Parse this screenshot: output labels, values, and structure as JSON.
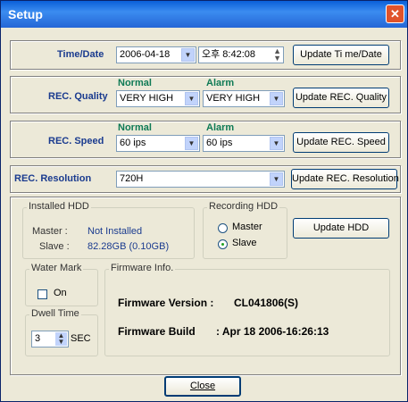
{
  "window": {
    "title": "Setup",
    "close_glyph": "✕"
  },
  "time_date": {
    "label": "Time/Date",
    "date": "2006-04-18",
    "time": "오후  8:42:08",
    "button": "Update Ti me/Date"
  },
  "rec_quality": {
    "label": "REC. Quality",
    "normal_header": "Normal",
    "alarm_header": "Alarm",
    "normal_value": "VERY HIGH",
    "alarm_value": "VERY HIGH",
    "button": "Update REC. Quality"
  },
  "rec_speed": {
    "label": "REC. Speed",
    "normal_header": "Normal",
    "alarm_header": "Alarm",
    "normal_value": "60 ips",
    "alarm_value": "60 ips",
    "button": "Update REC. Speed"
  },
  "rec_resolution": {
    "label": "REC. Resolution",
    "value": "720H",
    "button": "Update REC. Resolution"
  },
  "installed_hdd": {
    "legend": "Installed HDD",
    "master_label": "Master :",
    "master_value": "Not Installed",
    "slave_label": "Slave :",
    "slave_value": "82.28GB (0.10GB)"
  },
  "recording_hdd": {
    "legend": "Recording HDD",
    "option_master": "Master",
    "option_slave": "Slave",
    "selected": "Slave"
  },
  "update_hdd_button": "Update HDD",
  "water_mark": {
    "legend": "Water Mark",
    "checkbox_label": "On",
    "checked": false
  },
  "dwell_time": {
    "legend": "Dwell Time",
    "value": "3",
    "unit": "SEC"
  },
  "firmware": {
    "legend": "Firmware Info.",
    "version_label": "Firmware Version :",
    "version_value": "CL041806(S)",
    "build_label": "Firmware Build",
    "build_value": ":  Apr 18 2006-16:26:13"
  },
  "close_button": "Close"
}
